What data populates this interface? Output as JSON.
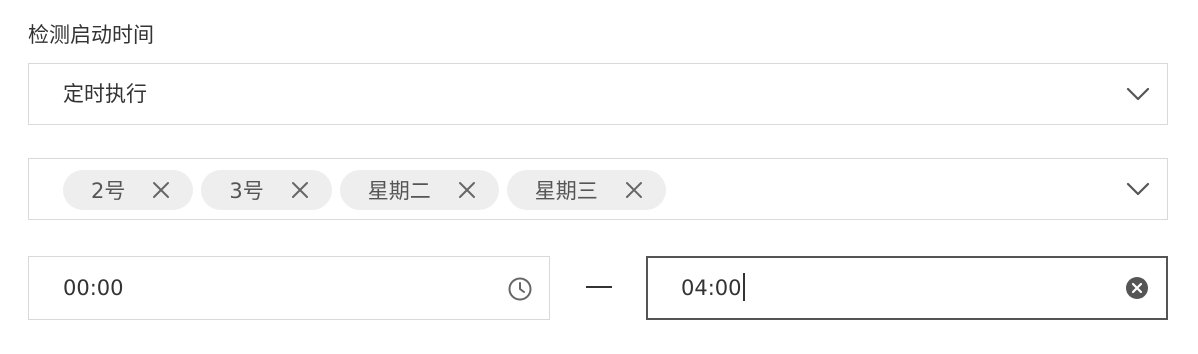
{
  "field": {
    "label": "检测启动时间"
  },
  "schedule_select": {
    "value": "定时执行",
    "icon": "chevron-down-icon"
  },
  "days_select": {
    "tags": [
      "2号",
      "3号",
      "星期二",
      "星期三"
    ],
    "icon": "chevron-down-icon"
  },
  "time_range": {
    "start": "00:00",
    "end": "04:00",
    "start_icon": "clock-icon",
    "end_icon": "clear-icon"
  },
  "colors": {
    "border": "#d9d9d9",
    "focused_border": "#555555",
    "tag_bg": "#eeeeee",
    "text": "#333333"
  }
}
